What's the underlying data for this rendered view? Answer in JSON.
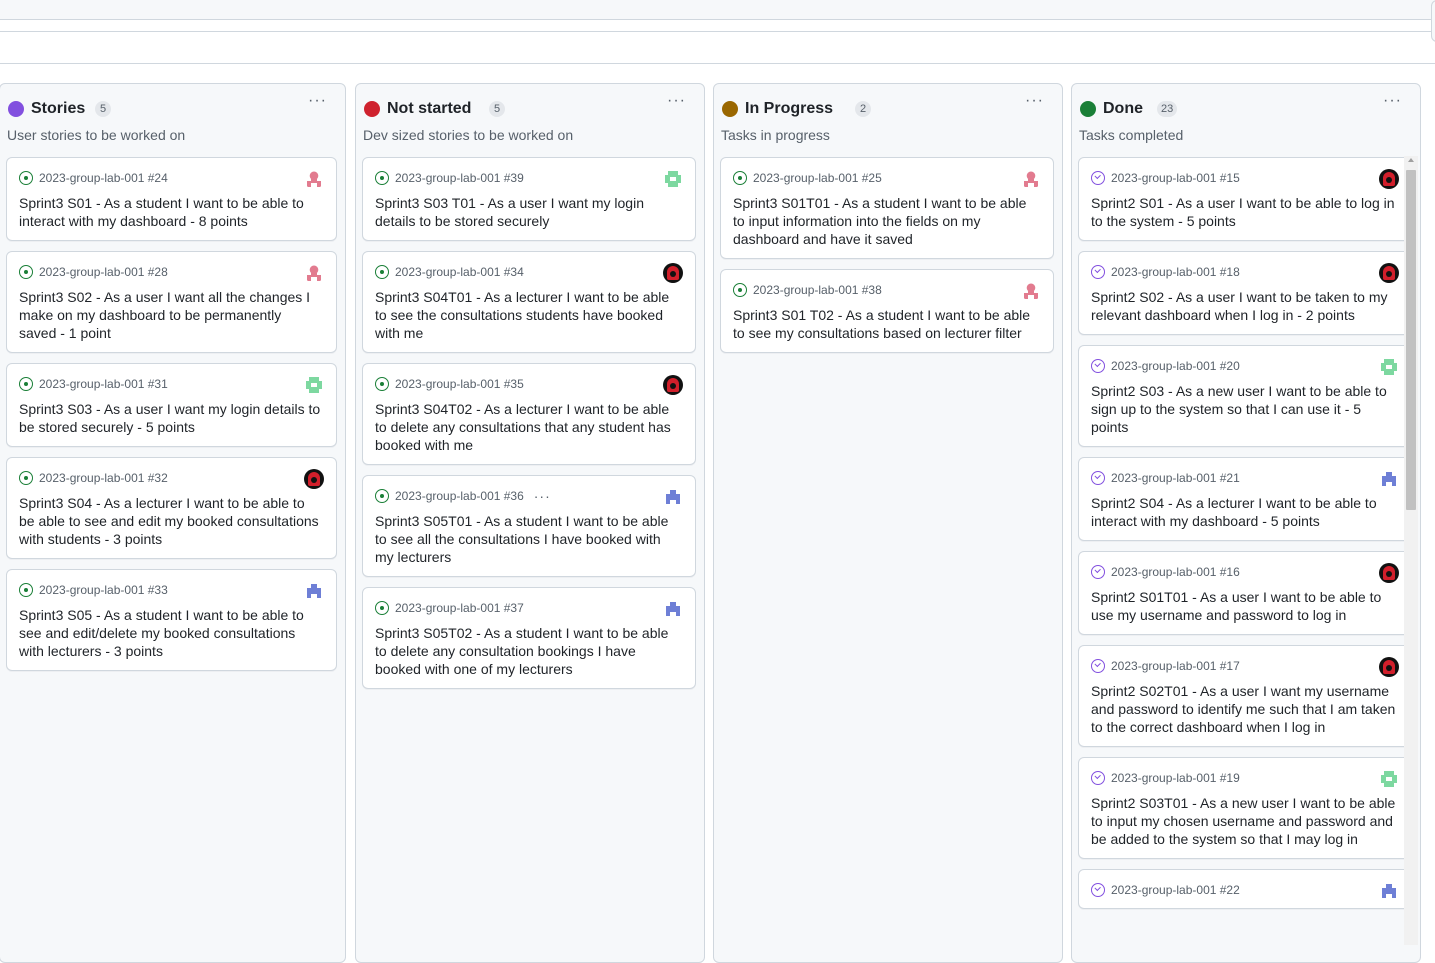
{
  "columns": [
    {
      "title": "Stories",
      "count": "5",
      "color": "#8250df",
      "menu": "···",
      "description": "User stories to be worked on",
      "cards": [
        {
          "ref": "2023-group-lab-001 #24",
          "title": "Sprint3 S01 - As a student I want to be able to interact with my dashboard - 8 points",
          "status": "open",
          "avatar": "pink"
        },
        {
          "ref": "2023-group-lab-001 #28",
          "title": "Sprint3 S02 - As a user I want all the changes I make on my dashboard to be permanently saved - 1 point",
          "status": "open",
          "avatar": "pink"
        },
        {
          "ref": "2023-group-lab-001 #31",
          "title": "Sprint3 S03 - As a user I want my login details to be stored securely - 5 points",
          "status": "open",
          "avatar": "green"
        },
        {
          "ref": "2023-group-lab-001 #32",
          "title": "Sprint3 S04 - As a lecturer I want to be able to be able to see and edit my booked consultations with students - 3 points",
          "status": "open",
          "avatar": "dark"
        },
        {
          "ref": "2023-group-lab-001 #33",
          "title": "Sprint3 S05 - As a student I want to be able to see and edit/delete my booked consultations with lecturers - 3 points",
          "status": "open",
          "avatar": "blue"
        }
      ]
    },
    {
      "title": "Not started",
      "count": "5",
      "color": "#cf222e",
      "menu": "···",
      "description": "Dev sized stories to be worked on",
      "cards": [
        {
          "ref": "2023-group-lab-001 #39",
          "title": "Sprint3 S03 T01 - As a user I want my login details to be stored securely",
          "status": "open",
          "avatar": "green"
        },
        {
          "ref": "2023-group-lab-001 #34",
          "title": "Sprint3 S04T01 - As a lecturer I want to be able to see the consultations students have booked with me",
          "status": "open",
          "avatar": "dark"
        },
        {
          "ref": "2023-group-lab-001 #35",
          "title": "Sprint3 S04T02 - As a lecturer I want to be able to delete any consultations that any student has booked with me",
          "status": "open",
          "avatar": "dark"
        },
        {
          "ref": "2023-group-lab-001 #36",
          "title": "Sprint3 S05T01 - As a student I want to be able to see all the consultations I have booked with my lecturers",
          "status": "open",
          "avatar": "blue",
          "more": "···"
        },
        {
          "ref": "2023-group-lab-001 #37",
          "title": "Sprint3 S05T02 - As a student I want to be able to delete any consultation bookings I have booked with one of my lecturers",
          "status": "open",
          "avatar": "blue"
        }
      ]
    },
    {
      "title": "In Progress",
      "count": "2",
      "color": "#9a6700",
      "menu": "···",
      "description": "Tasks in progress",
      "cards": [
        {
          "ref": "2023-group-lab-001 #25",
          "title": "Sprint3 S01T01 - As a student I want to be able to input information into the fields on my dashboard and have it saved",
          "status": "open",
          "avatar": "pink"
        },
        {
          "ref": "2023-group-lab-001 #38",
          "title": "Sprint3 S01 T02 - As a student I want to be able to see my consultations based on lecturer filter",
          "status": "open",
          "avatar": "pink"
        }
      ]
    },
    {
      "title": "Done",
      "count": "23",
      "color": "#1a7f37",
      "menu": "···",
      "description": "Tasks completed",
      "cards": [
        {
          "ref": "2023-group-lab-001 #15",
          "title": "Sprint2 S01 - As a user I want to be able to log in to the system - 5 points",
          "status": "closed",
          "avatar": "dark"
        },
        {
          "ref": "2023-group-lab-001 #18",
          "title": "Sprint2 S02 - As a user I want to be taken to my relevant dashboard when I log in - 2 points",
          "status": "closed",
          "avatar": "dark"
        },
        {
          "ref": "2023-group-lab-001 #20",
          "title": "Sprint2 S03 - As a new user I want to be able to sign up to the system so that I can use it - 5 points",
          "status": "closed",
          "avatar": "green"
        },
        {
          "ref": "2023-group-lab-001 #21",
          "title": "Sprint2 S04 - As a lecturer I want to be able to interact with my dashboard - 5 points",
          "status": "closed",
          "avatar": "blue"
        },
        {
          "ref": "2023-group-lab-001 #16",
          "title": "Sprint2 S01T01 - As a user I want to be able to use my username and password to log in",
          "status": "closed",
          "avatar": "dark"
        },
        {
          "ref": "2023-group-lab-001 #17",
          "title": "Sprint2 S02T01 - As a user I want my username and password to identify me such that I am taken to the correct dashboard when I log in",
          "status": "closed",
          "avatar": "dark"
        },
        {
          "ref": "2023-group-lab-001 #19",
          "title": "Sprint2 S03T01 - As a new user I want to be able to input my chosen username and password and be added to the system so that I may log in",
          "status": "closed",
          "avatar": "green"
        },
        {
          "ref": "2023-group-lab-001 #22",
          "title": "",
          "status": "closed",
          "avatar": "blue"
        }
      ]
    }
  ]
}
